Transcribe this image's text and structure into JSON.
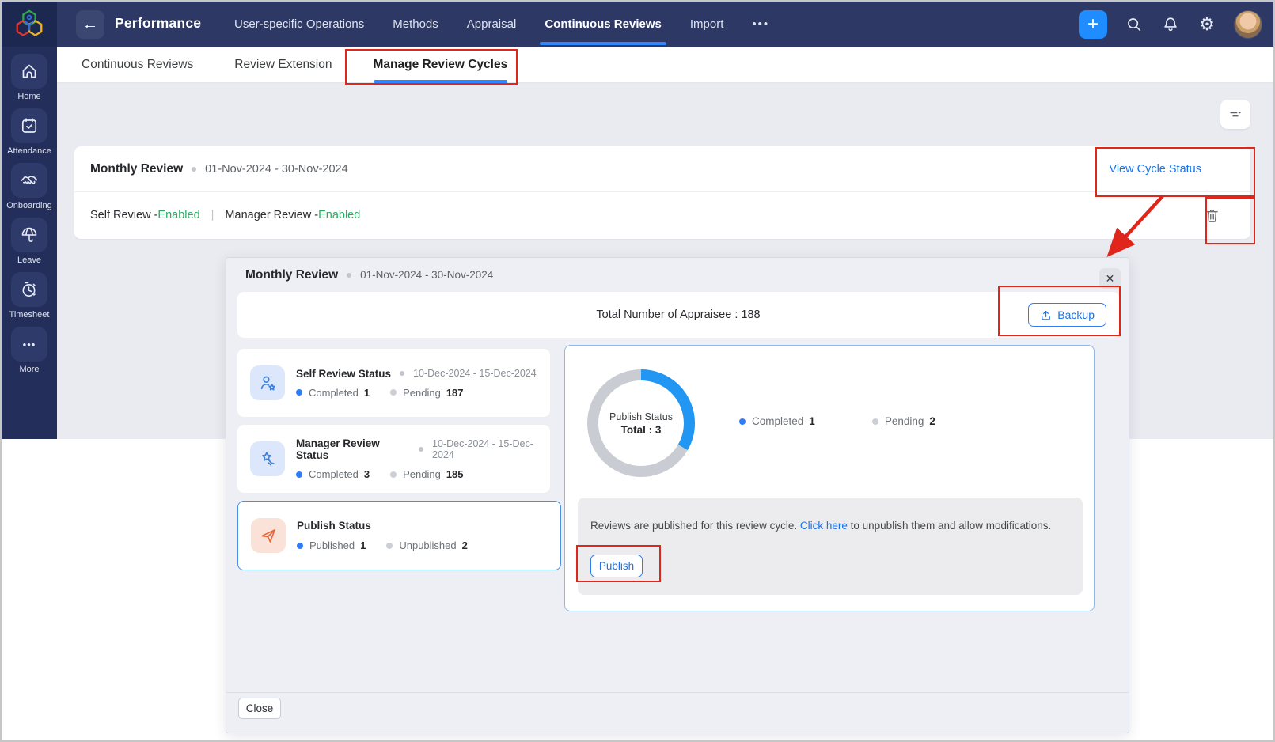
{
  "topbar": {
    "title": "Performance",
    "back_icon": "←",
    "nav": [
      {
        "label": "User-specific Operations",
        "active": false
      },
      {
        "label": "Methods",
        "active": false
      },
      {
        "label": "Appraisal",
        "active": false
      },
      {
        "label": "Continuous Reviews",
        "active": true
      },
      {
        "label": "Import",
        "active": false
      },
      {
        "label": "•••",
        "active": false
      }
    ],
    "plus_icon": "+",
    "gear_icon": "⚙"
  },
  "sidebar": {
    "items": [
      {
        "label": "Home",
        "icon": "home-icon"
      },
      {
        "label": "Attendance",
        "icon": "calendar-check-icon"
      },
      {
        "label": "Onboarding",
        "icon": "handshake-icon"
      },
      {
        "label": "Leave",
        "icon": "umbrella-icon"
      },
      {
        "label": "Timesheet",
        "icon": "timer-icon"
      },
      {
        "label": "More",
        "icon": "ellipsis-icon",
        "icon_text": "•••"
      }
    ]
  },
  "tabs": [
    {
      "label": "Continuous Reviews",
      "active": false
    },
    {
      "label": "Review Extension",
      "active": false
    },
    {
      "label": "Manage Review Cycles",
      "active": true
    }
  ],
  "cycle_card": {
    "title": "Monthly Review",
    "date_range": "01-Nov-2024 - 30-Nov-2024",
    "view_cycle_status": "View Cycle Status",
    "self_review_label": "Self Review - ",
    "self_review_value": "Enabled",
    "pipe": "|",
    "manager_review_label": "Manager Review - ",
    "manager_review_value": "Enabled"
  },
  "modal": {
    "title": "Monthly Review",
    "date_range": "01-Nov-2024 - 30-Nov-2024",
    "close_icon": "✕",
    "total_appraisee": "Total Number of Appraisee : 188",
    "backup_label": "Backup",
    "status_cards": [
      {
        "title": "Self Review Status",
        "date_range": "10-Dec-2024 - 15-Dec-2024",
        "stat1_label": "Completed",
        "stat1_value": "1",
        "stat2_label": "Pending",
        "stat2_value": "187"
      },
      {
        "title": "Manager Review Status",
        "date_range": "10-Dec-2024 - 15-Dec-2024",
        "stat1_label": "Completed",
        "stat1_value": "3",
        "stat2_label": "Pending",
        "stat2_value": "185"
      },
      {
        "title": "Publish Status",
        "stat1_label": "Published",
        "stat1_value": "1",
        "stat2_label": "Unpublished",
        "stat2_value": "2"
      }
    ],
    "donut": {
      "type": "donut",
      "center_line1": "Publish Status",
      "center_line2": "Total : 3",
      "completed": 1,
      "pending": 2,
      "total": 3,
      "completed_label": "Completed",
      "completed_value": "1",
      "pending_label": "Pending",
      "pending_value": "2",
      "completed_color": "#2196f3",
      "pending_color": "#c9cdd3"
    },
    "publish_note": {
      "text_before": "Reviews are published for this review cycle. ",
      "link": "Click here",
      "text_after": " to unpublish them and allow modifications."
    },
    "publish_button": "Publish",
    "close_button": "Close"
  },
  "colors": {
    "topbar_bg": "#2d3964",
    "sidebar_bg": "#232e5a",
    "accent_blue": "#1a73e8",
    "enabled_green": "#27ae60",
    "annotation_red": "#e0251b",
    "page_bg": "#e9ebf1"
  }
}
